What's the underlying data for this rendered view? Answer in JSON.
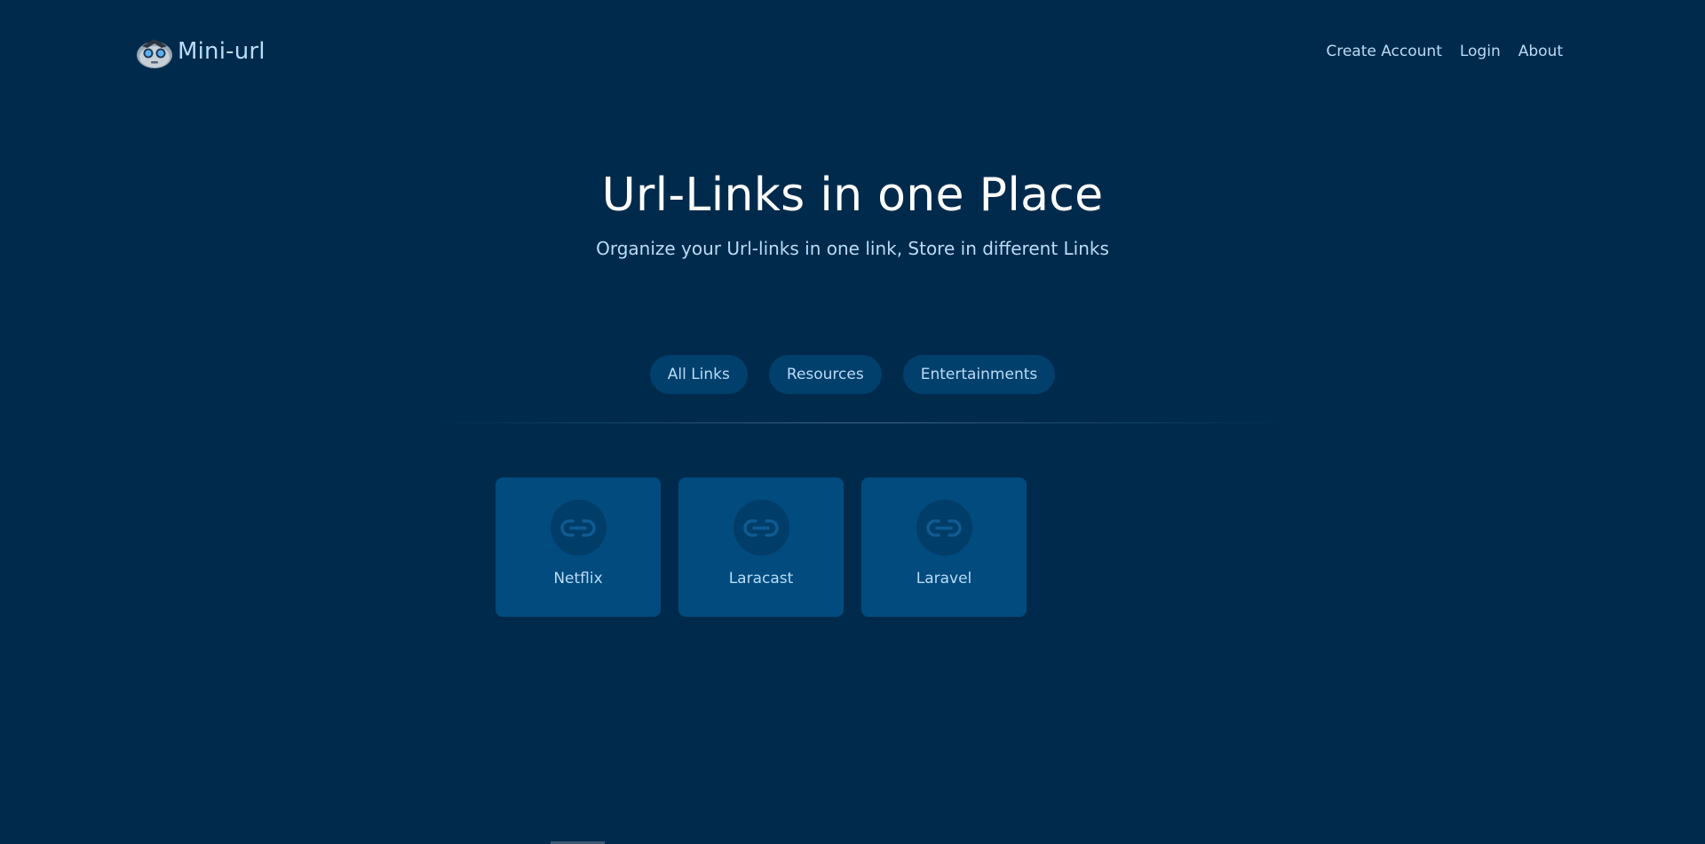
{
  "header": {
    "brand_name": "Mini-url",
    "nav": [
      {
        "label": "Create Account"
      },
      {
        "label": "Login"
      },
      {
        "label": "About"
      }
    ]
  },
  "hero": {
    "title": "Url-Links in one Place",
    "subtitle": "Organize your Url-links in one link, Store in different Links"
  },
  "filters": [
    {
      "label": "All Links"
    },
    {
      "label": "Resources"
    },
    {
      "label": "Entertainments"
    }
  ],
  "links": [
    {
      "label": "Netflix",
      "icon": "link-icon"
    },
    {
      "label": "Laracast",
      "icon": "link-icon"
    },
    {
      "label": "Laravel",
      "icon": "link-icon"
    }
  ],
  "colors": {
    "background": "#002a4b",
    "card": "#014b7e",
    "pill": "#013f6c",
    "text_accent": "#b9dcf7"
  }
}
